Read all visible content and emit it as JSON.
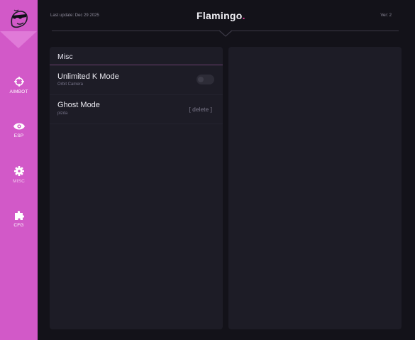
{
  "header": {
    "last_update": "Last update: Dec 29 2025",
    "brand": "Flamingo",
    "brand_dot": ".",
    "version": "Ver: 2"
  },
  "colors": {
    "sidebar": "#d259c8",
    "background": "#131219",
    "panel": "#1d1c26",
    "accent_dot": "#e0409a"
  },
  "sidebar": {
    "logo_icon": "flamingo-sunglasses-logo",
    "items": [
      {
        "label": "AIMBOT",
        "icon": "crosshair-icon",
        "active": false
      },
      {
        "label": "ESP",
        "icon": "eye-icon",
        "active": false
      },
      {
        "label": "MISC",
        "icon": "gear-icon",
        "active": true
      },
      {
        "label": "CFG",
        "icon": "puzzle-icon",
        "active": false
      }
    ]
  },
  "main": {
    "left_panel": {
      "title": "Misc",
      "rows": [
        {
          "title": "Unlimited K Mode",
          "subtitle": "Orbit Camera",
          "control": "toggle",
          "value": false
        },
        {
          "title": "Ghost Mode",
          "subtitle": "pizda",
          "control": "link",
          "link_label": "[ delete ]"
        }
      ]
    },
    "right_panel": {}
  }
}
